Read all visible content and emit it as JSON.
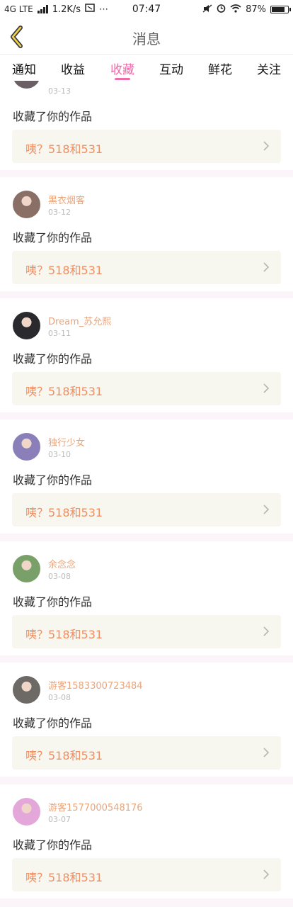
{
  "status_bar": {
    "network": "4G LTE",
    "speed": "1.2K/s",
    "extra": "⋯",
    "time": "07:47",
    "battery": "87%",
    "battery_level": 0.87
  },
  "header": {
    "title": "消息",
    "back_icon": "back-chevron-icon"
  },
  "tabs": [
    {
      "label": "通知",
      "active": false
    },
    {
      "label": "收益",
      "active": false
    },
    {
      "label": "收藏",
      "active": true
    },
    {
      "label": "互动",
      "active": false
    },
    {
      "label": "鲜花",
      "active": false
    },
    {
      "label": "关注",
      "active": false
    }
  ],
  "colors": {
    "accent": "#f06ba9",
    "username": "#e8a57c",
    "work_title": "#ef8f63",
    "work_bg": "#f7f6ef",
    "page_bg": "#fbf5fa"
  },
  "notifications": [
    {
      "username": "",
      "date": "03-13",
      "action": "收藏了你的作品",
      "work_title": "咦？518和531",
      "avatar_color": "#6b5f66"
    },
    {
      "username": "黑衣烟客",
      "date": "03-12",
      "action": "收藏了你的作品",
      "work_title": "咦？518和531",
      "avatar_color": "#8a6f66"
    },
    {
      "username": "Dream_苏允熙",
      "date": "03-11",
      "action": "收藏了你的作品",
      "work_title": "咦？518和531",
      "avatar_color": "#2a2a2e"
    },
    {
      "username": "独行少女",
      "date": "03-10",
      "action": "收藏了你的作品",
      "work_title": "咦？518和531",
      "avatar_color": "#8a7fb8"
    },
    {
      "username": "余念念",
      "date": "03-08",
      "action": "收藏了你的作品",
      "work_title": "咦？518和531",
      "avatar_color": "#7aa06a"
    },
    {
      "username": "游客1583300723484",
      "date": "03-08",
      "action": "收藏了你的作品",
      "work_title": "咦？518和531",
      "avatar_color": "#6d6a66"
    },
    {
      "username": "游客1577000548176",
      "date": "03-07",
      "action": "收藏了你的作品",
      "work_title": "咦？518和531",
      "avatar_color": "#e3a7d9"
    }
  ]
}
